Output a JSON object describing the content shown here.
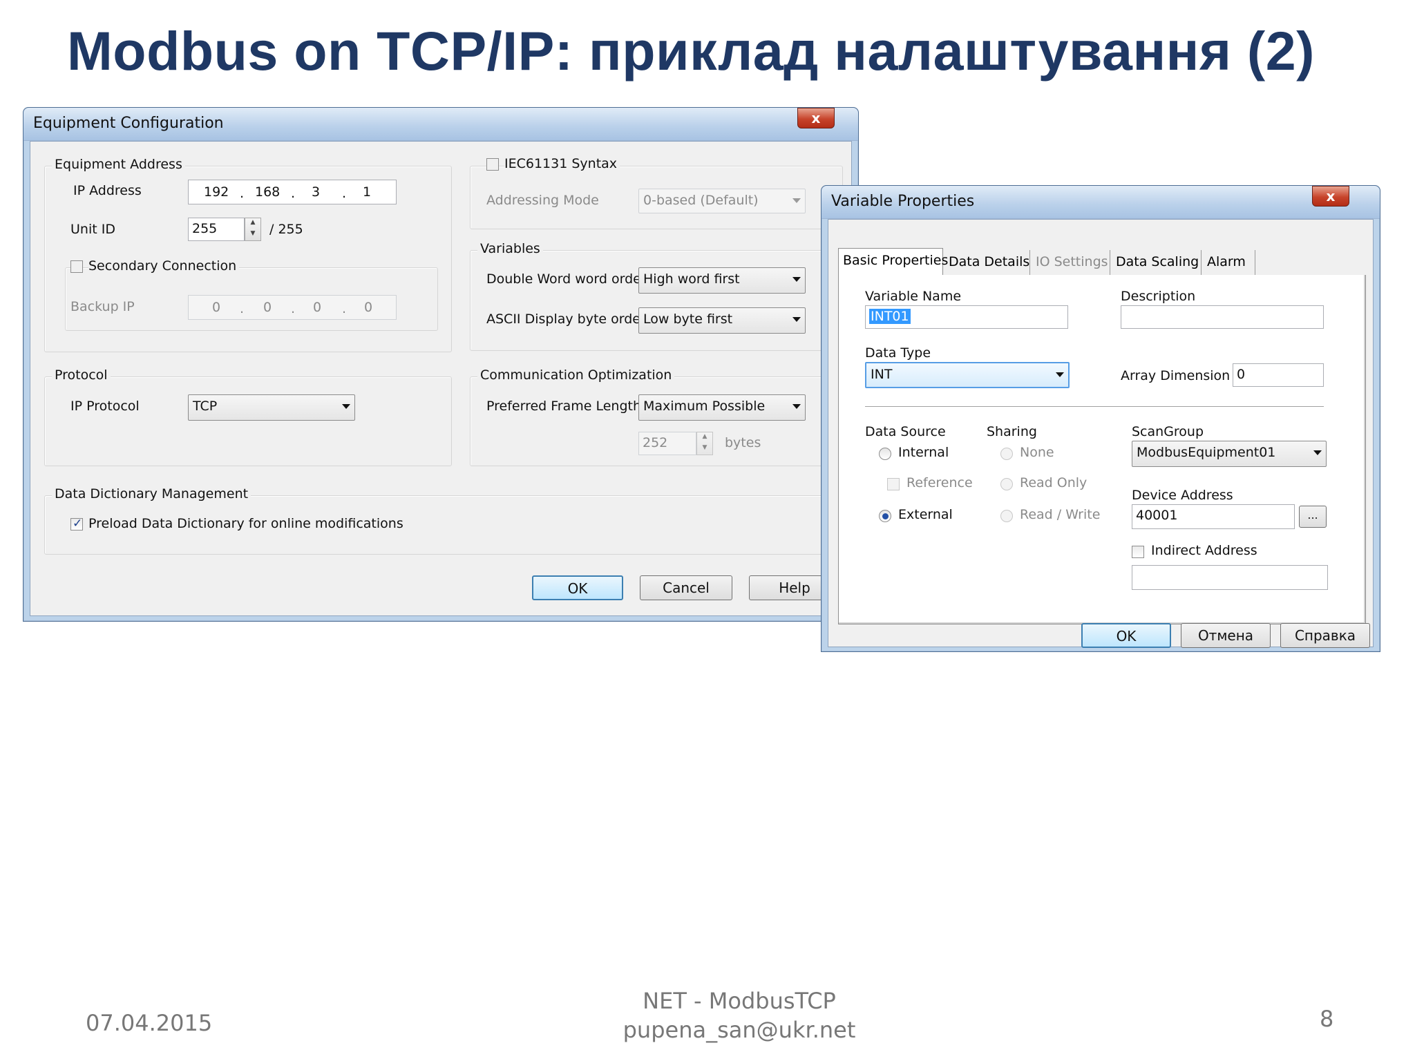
{
  "slide": {
    "title": "Modbus on TCP/IP: приклад налаштування (2)",
    "date": "07.04.2015",
    "footer_line1": "NET - ModbusTCP",
    "footer_line2": "pupena_san@ukr.net",
    "page_number": "8"
  },
  "equipment_config": {
    "window_title": "Equipment Configuration",
    "close_label": "x",
    "equipment_address": {
      "group_title": "Equipment Address",
      "ip_label": "IP Address",
      "ip_octets": [
        "192",
        "168",
        "3",
        "1"
      ],
      "dot": ".",
      "unit_id_label": "Unit ID",
      "unit_id_value": "255",
      "unit_id_max": "/ 255",
      "secondary_label": "Secondary Connection",
      "backup_ip_label": "Backup IP",
      "backup_octets": [
        "0",
        "0",
        "0",
        "0"
      ]
    },
    "iec": {
      "label": "IEC61131 Syntax",
      "addressing_mode_label": "Addressing Mode",
      "addressing_mode_value": "0-based (Default)"
    },
    "variables": {
      "group_title": "Variables",
      "dword_label": "Double Word word order",
      "dword_value": "High word first",
      "ascii_label": "ASCII Display byte order",
      "ascii_value": "Low byte first"
    },
    "protocol": {
      "group_title": "Protocol",
      "ip_protocol_label": "IP Protocol",
      "ip_protocol_value": "TCP"
    },
    "comm_opt": {
      "group_title": "Communication Optimization",
      "frame_label": "Preferred Frame Length",
      "frame_value": "Maximum Possible",
      "bytes_value": "252",
      "bytes_unit": "bytes"
    },
    "data_dict": {
      "group_title": "Data Dictionary Management",
      "preload_label": "Preload Data Dictionary for online modifications"
    },
    "buttons": {
      "ok": "OK",
      "cancel": "Cancel",
      "help": "Help"
    }
  },
  "variable_props": {
    "window_title": "Variable Properties",
    "close_label": "x",
    "tabs": [
      "Basic Properties",
      "Data Details",
      "IO Settings",
      "Data Scaling",
      "Alarm"
    ],
    "variable_name_label": "Variable Name",
    "variable_name_value": "INT01",
    "description_label": "Description",
    "description_value": "",
    "data_type_label": "Data Type",
    "data_type_value": "INT",
    "array_dim_label": "Array Dimension",
    "array_dim_value": "0",
    "data_source_label": "Data Source",
    "internal_label": "Internal",
    "reference_label": "Reference",
    "external_label": "External",
    "sharing_label": "Sharing",
    "none_label": "None",
    "read_only_label": "Read Only",
    "read_write_label": "Read / Write",
    "scangroup_label": "ScanGroup",
    "scangroup_value": "ModbusEquipment01",
    "device_address_label": "Device Address",
    "device_address_value": "40001",
    "browse_label": "...",
    "indirect_label": "Indirect Address",
    "indirect_value": "",
    "buttons": {
      "ok": "OK",
      "cancel": "Отмена",
      "help": "Справка"
    }
  }
}
